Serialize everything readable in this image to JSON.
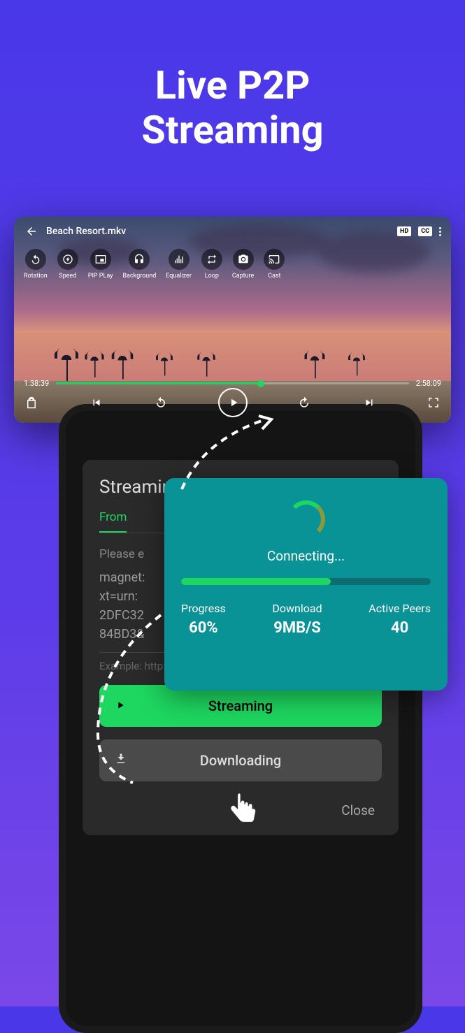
{
  "hero": {
    "line1": "Live P2P",
    "line2": "Streaming"
  },
  "player": {
    "filename": "Beach Resort.mkv",
    "badges": {
      "hd": "HD",
      "cc": "CC"
    },
    "tools": [
      {
        "name": "rotation",
        "label": "Rotation"
      },
      {
        "name": "speed",
        "label": "Speed"
      },
      {
        "name": "pip",
        "label": "PIP PLay"
      },
      {
        "name": "background",
        "label": "Background"
      },
      {
        "name": "equalizer",
        "label": "Equalizer"
      },
      {
        "name": "loop",
        "label": "Loop"
      },
      {
        "name": "capture",
        "label": "Capture"
      },
      {
        "name": "cast",
        "label": "Cast"
      }
    ],
    "current_time": "1:38:39",
    "total_time": "2:58:09"
  },
  "modal": {
    "title": "Streaming",
    "active_tab": "From",
    "input_label": "Please e",
    "magnet_lines": [
      "magnet:",
      "xt=urn:",
      "2DFC32",
      "84BD3&"
    ],
    "example": "Example: http://www.example.com/video.mkv",
    "streaming_btn": "Streaming",
    "downloading_btn": "Downloading",
    "close": "Close"
  },
  "connecting": {
    "status": "Connecting...",
    "progress_label": "Progress",
    "progress_value": "60%",
    "download_label": "Download",
    "download_value": "9MB/S",
    "peers_label": "Active Peers",
    "peers_value": "40"
  }
}
